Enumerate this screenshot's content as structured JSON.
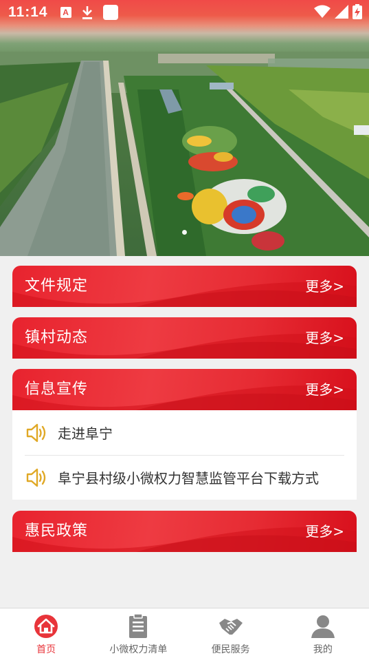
{
  "status_bar": {
    "time": "11:14",
    "left_icons": [
      "text-a-icon",
      "download-icon",
      "square-app-icon"
    ],
    "right_icons": [
      "wifi-icon",
      "cellular-signal-icon",
      "battery-charging-icon"
    ]
  },
  "banner": {
    "description_icon": "aerial-park-photo",
    "page_count": 1,
    "active_index": 0
  },
  "sections": [
    {
      "title": "文件规定",
      "more": "更多>"
    },
    {
      "title": "镇村动态",
      "more": "更多>"
    },
    {
      "title": "信息宣传",
      "more": "更多>",
      "items": [
        {
          "text": "走进阜宁",
          "icon": "speaker-icon"
        },
        {
          "text": "阜宁县村级小微权力智慧监管平台下载方式",
          "icon": "speaker-icon"
        }
      ]
    },
    {
      "title": "惠民政策",
      "more": "更多>"
    }
  ],
  "bottom_nav": [
    {
      "label": "首页",
      "icon": "home-icon",
      "active": true
    },
    {
      "label": "小微权力清单",
      "icon": "clipboard-icon",
      "active": false
    },
    {
      "label": "便民服务",
      "icon": "handshake-icon",
      "active": false
    },
    {
      "label": "我的",
      "icon": "user-icon",
      "active": false
    }
  ],
  "colors": {
    "primary_red": "#e8343a",
    "header_gradient_dark": "#d8101c",
    "speaker_gold": "#e0a825",
    "nav_inactive": "#888888"
  }
}
